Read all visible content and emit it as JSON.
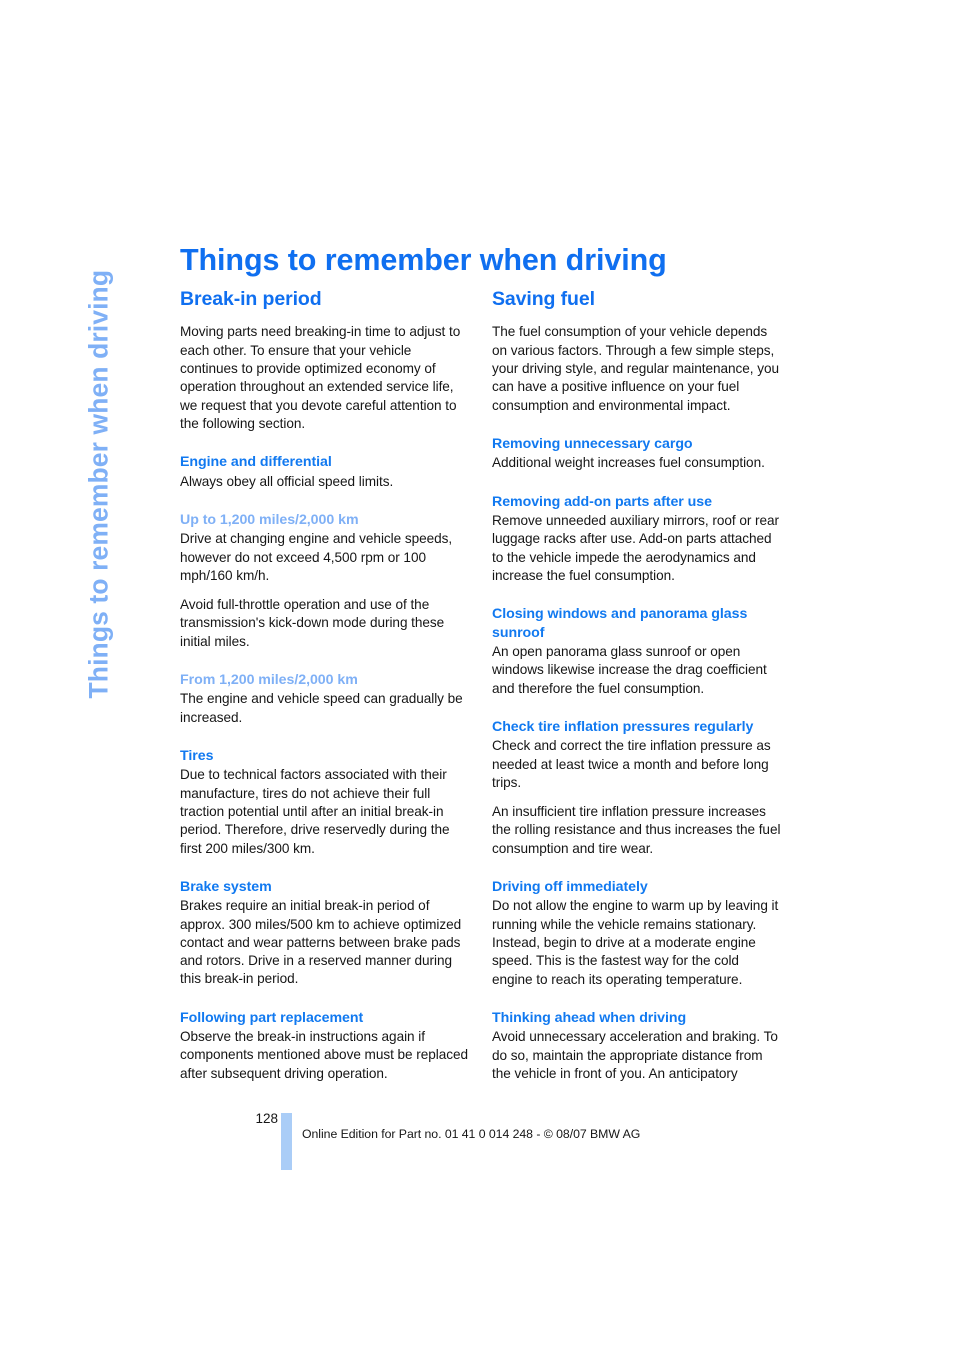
{
  "document": {
    "running_head": "Things to remember when driving",
    "title": "Things to remember when driving"
  },
  "columns": {
    "left": {
      "section_title": "Break-in period",
      "intro": "Moving parts need breaking-in time to adjust to each other. To ensure that your vehicle continues to provide optimized economy of operation throughout an extended service life, we request that you devote careful attention to the following section.",
      "blocks": [
        {
          "heading": "Engine and differential",
          "heading_style": "primary",
          "paragraphs": [
            "Always obey all official speed limits."
          ]
        },
        {
          "heading": "Up to 1,200 miles/2,000 km",
          "heading_style": "light",
          "paragraphs": [
            "Drive at changing engine and vehicle speeds, however do not exceed 4,500 rpm or 100 mph/160 km/h.",
            "Avoid full-throttle operation and use of the transmission's kick-down mode during these initial miles."
          ]
        },
        {
          "heading": "From 1,200 miles/2,000 km",
          "heading_style": "light",
          "paragraphs": [
            "The engine and vehicle speed can gradually be increased."
          ]
        },
        {
          "heading": "Tires",
          "heading_style": "primary",
          "paragraphs": [
            "Due to technical factors associated with their manufacture, tires do not achieve their full traction potential until after an initial break-in period. Therefore, drive reservedly during the first 200 miles/300 km."
          ]
        },
        {
          "heading": "Brake system",
          "heading_style": "primary",
          "paragraphs": [
            "Brakes require an initial break-in period of approx. 300 miles/500 km to achieve optimized contact and wear patterns between brake pads and rotors. Drive in a reserved manner during this break-in period."
          ]
        },
        {
          "heading": "Following part replacement",
          "heading_style": "primary",
          "paragraphs": [
            "Observe the break-in instructions again if components mentioned above must be replaced after subsequent driving operation."
          ]
        }
      ]
    },
    "right": {
      "section_title": "Saving fuel",
      "intro": "The fuel consumption of your vehicle depends on various factors. Through a few simple steps, your driving style, and regular maintenance, you can have a positive influence on your fuel consumption and environmental impact.",
      "blocks": [
        {
          "heading": "Removing unnecessary cargo",
          "heading_style": "primary",
          "paragraphs": [
            "Additional weight increases fuel consumption."
          ]
        },
        {
          "heading": "Removing add-on parts after use",
          "heading_style": "primary",
          "paragraphs": [
            "Remove unneeded auxiliary mirrors, roof or rear luggage racks after use. Add-on parts attached to the vehicle impede the aerodynamics and increase the fuel consumption."
          ]
        },
        {
          "heading": "Closing windows and panorama glass sunroof",
          "heading_style": "primary",
          "paragraphs": [
            "An open panorama glass sunroof or open windows likewise increase the drag coefficient and therefore the fuel consumption."
          ]
        },
        {
          "heading": "Check tire inflation pressures regularly",
          "heading_style": "primary",
          "paragraphs": [
            "Check and correct the tire inflation pressure as needed at least twice a month and before long trips.",
            "An insufficient tire inflation pressure increases the rolling resistance and thus increases the fuel consumption and tire wear."
          ]
        },
        {
          "heading": "Driving off immediately",
          "heading_style": "primary",
          "paragraphs": [
            "Do not allow the engine to warm up by leaving it running while the vehicle remains stationary. Instead, begin to drive at a moderate engine speed. This is the fastest way for the cold engine to reach its operating temperature."
          ]
        },
        {
          "heading": "Thinking ahead when driving",
          "heading_style": "primary",
          "paragraphs": [
            "Avoid unnecessary acceleration and braking. To do so, maintain the appropriate distance from the vehicle in front of you. An anticipatory"
          ]
        }
      ]
    }
  },
  "footer": {
    "page_number": "128",
    "note": "Online Edition for Part no. 01 41 0 014 248 - © 08/07 BMW AG"
  },
  "colors": {
    "heading_blue": "#0f6ff0",
    "sub_heading_blue": "#1179f0",
    "light_blue": "#7fb0f6",
    "footer_bar_blue": "#aacdf7",
    "body_text": "#161616"
  }
}
